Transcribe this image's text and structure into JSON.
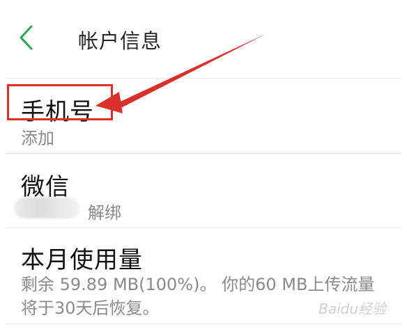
{
  "header": {
    "back_icon": "chevron-left-icon",
    "title": "帐户信息"
  },
  "phone": {
    "title": "手机号",
    "subtitle": "添加"
  },
  "wechat": {
    "title": "微信",
    "action": "解绑"
  },
  "usage": {
    "title": "本月使用量",
    "description": "剩余 59.89 MB(100%)。 你的60 MB上传流量将于30天后恢复。"
  },
  "annotation": {
    "color": "#d9302c"
  },
  "watermark": "Baidu经验",
  "colors": {
    "accent": "#2aa44f"
  }
}
